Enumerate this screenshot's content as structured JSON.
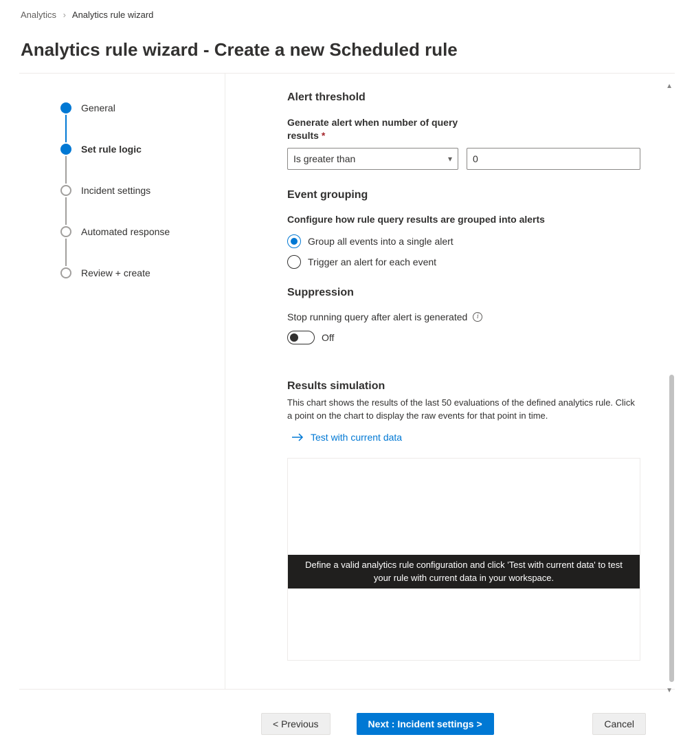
{
  "breadcrumb": {
    "root": "Analytics",
    "current": "Analytics rule wizard"
  },
  "page_title": "Analytics rule wizard - Create a new Scheduled rule",
  "steps": [
    {
      "label": "General"
    },
    {
      "label": "Set rule logic"
    },
    {
      "label": "Incident settings"
    },
    {
      "label": "Automated response"
    },
    {
      "label": "Review + create"
    }
  ],
  "alert_threshold": {
    "heading": "Alert threshold",
    "field_label": "Generate alert when number of query results",
    "required_mark": "*",
    "operator": "Is greater than",
    "value": "0"
  },
  "event_grouping": {
    "heading": "Event grouping",
    "sub_label": "Configure how rule query results are grouped into alerts",
    "opt1": "Group all events into a single alert",
    "opt2": "Trigger an alert for each event"
  },
  "suppression": {
    "heading": "Suppression",
    "label": "Stop running query after alert is generated",
    "state_text": "Off"
  },
  "results": {
    "heading": "Results simulation",
    "description": "This chart shows the results of the last 50 evaluations of the defined analytics rule. Click a point on the chart to display the raw events for that point in time.",
    "test_link": "Test with current data",
    "banner": "Define a valid analytics rule configuration and click 'Test with current data' to test your rule with current data in your workspace."
  },
  "footer": {
    "previous": "< Previous",
    "next": "Next : Incident settings >",
    "cancel": "Cancel"
  }
}
